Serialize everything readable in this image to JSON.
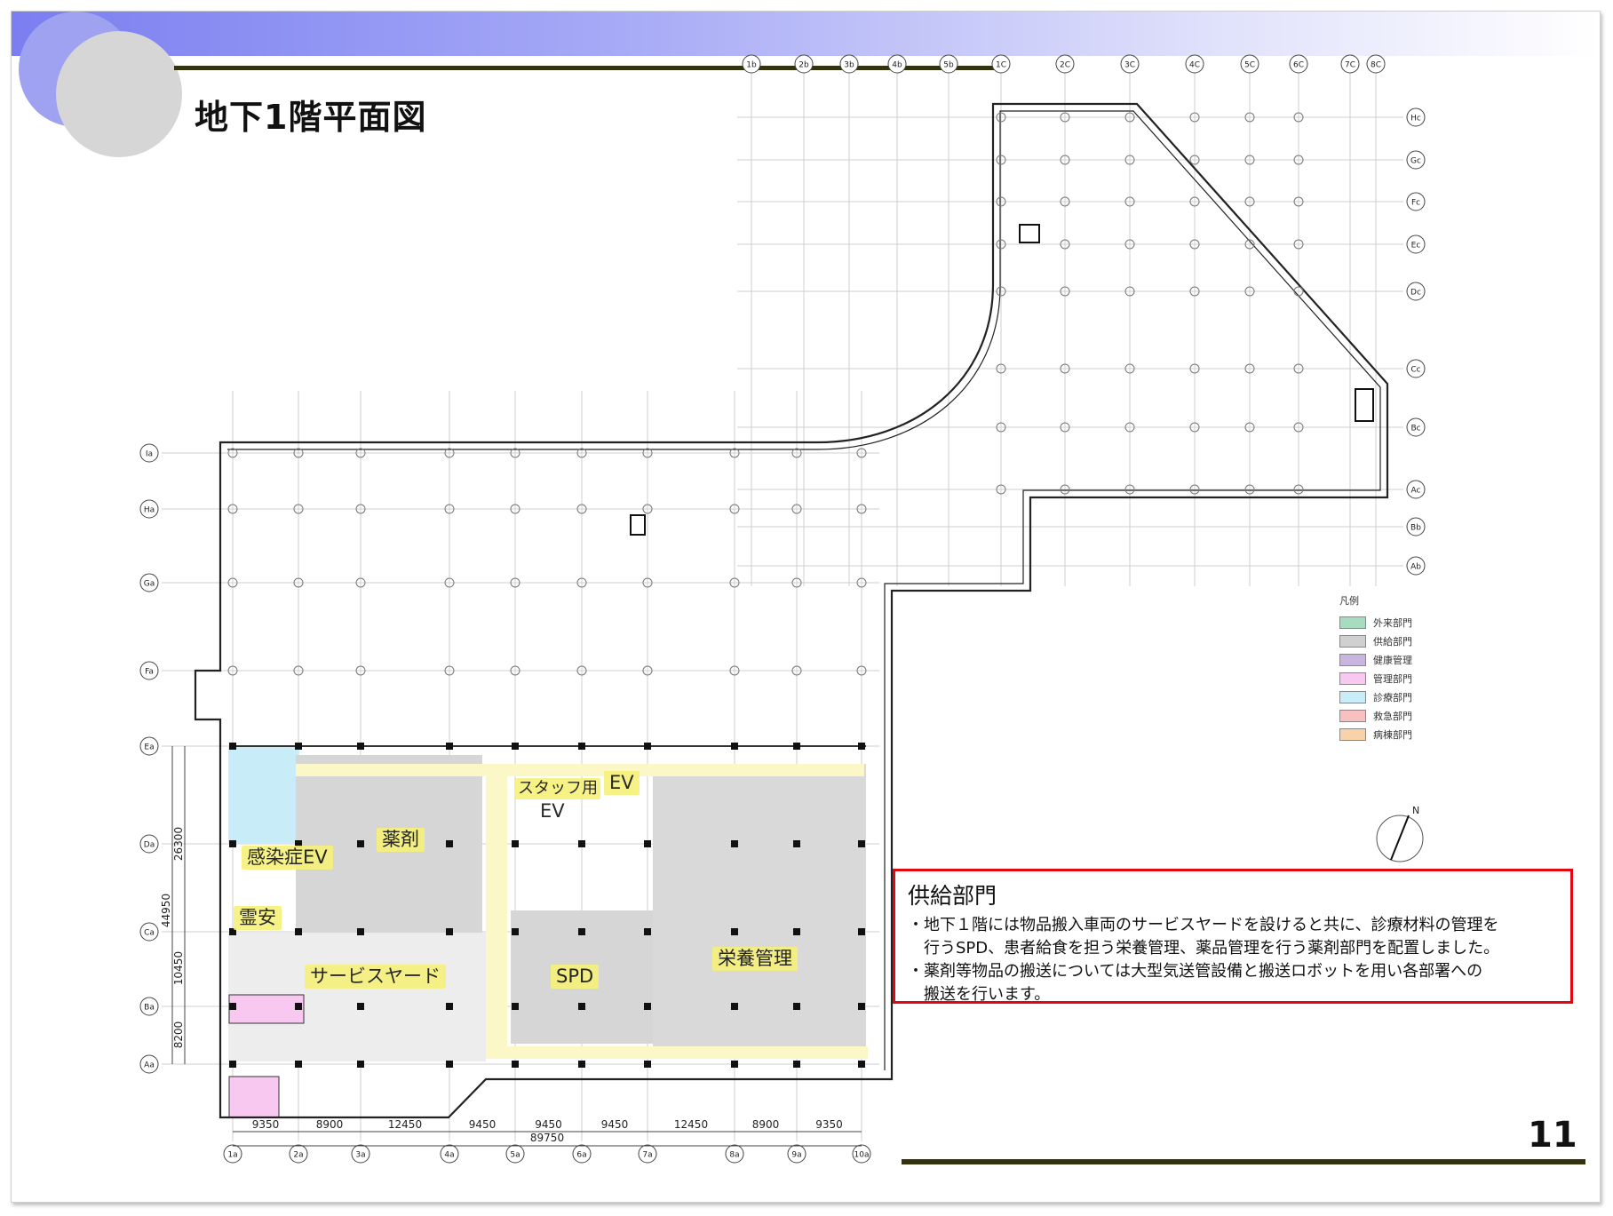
{
  "page": {
    "title": "地下1階平面図",
    "page_number": "11"
  },
  "colors": {
    "accent_band": "#7a7ef0",
    "rule": "#33330e",
    "highlight": "#f6f17a",
    "infobox_border": "#e30613"
  },
  "grid_top_labels": [
    "1b",
    "2b",
    "3b",
    "4b",
    "5b",
    "1C",
    "2C",
    "3C",
    "4C",
    "5C",
    "6C",
    "7C",
    "8C"
  ],
  "grid_bottom_labels": [
    "1a",
    "2a",
    "3a",
    "4a",
    "5a",
    "6a",
    "7a",
    "8a",
    "9a",
    "10a"
  ],
  "grid_right_labels": [
    "Hc",
    "Gc",
    "Fc",
    "Ec",
    "Dc",
    "Cc",
    "Bc",
    "Ac",
    "Bb",
    "Ab"
  ],
  "grid_left_labels": [
    "Ia",
    "Ha",
    "Ga",
    "Fa",
    "Ea",
    "Da",
    "Ca",
    "Ba",
    "Aa"
  ],
  "dims_bottom": [
    "9350",
    "8900",
    "12450",
    "9450",
    "9450",
    "9450",
    "12450",
    "8900",
    "9350"
  ],
  "dim_total": "89750",
  "dims_left": [
    "26300",
    "44950",
    "10450",
    "8200"
  ],
  "rooms": {
    "r1": "スタッフ用",
    "r1b": "EV",
    "r2": "EV",
    "r3": "薬剤",
    "r4": "感染症EV",
    "r5": "霊安",
    "r6": "サービスヤード",
    "r7": "SPD",
    "r8": "栄養管理"
  },
  "legend": {
    "title": "凡例",
    "items": [
      {
        "label": "外来部門",
        "color": "#a8dcc0"
      },
      {
        "label": "供給部門",
        "color": "#d0d0d0"
      },
      {
        "label": "健康管理",
        "color": "#c9b6e0"
      },
      {
        "label": "管理部門",
        "color": "#f8c8f0"
      },
      {
        "label": "診療部門",
        "color": "#c8ecf8"
      },
      {
        "label": "救急部門",
        "color": "#f8c0c0"
      },
      {
        "label": "病棟部門",
        "color": "#f8d2a8"
      }
    ]
  },
  "compass": {
    "label": "N"
  },
  "infobox": {
    "title": "供給部門",
    "lines": [
      "・地下１階には物品搬入車両のサービスヤードを設けると共に、診療材料の管理を",
      "　行うSPD、患者給食を担う栄養管理、薬品管理を行う薬剤部門を配置しました。",
      "・薬剤等物品の搬送については大型気送管設備と搬送ロボットを用い各部署への",
      "　搬送を行います。"
    ]
  }
}
